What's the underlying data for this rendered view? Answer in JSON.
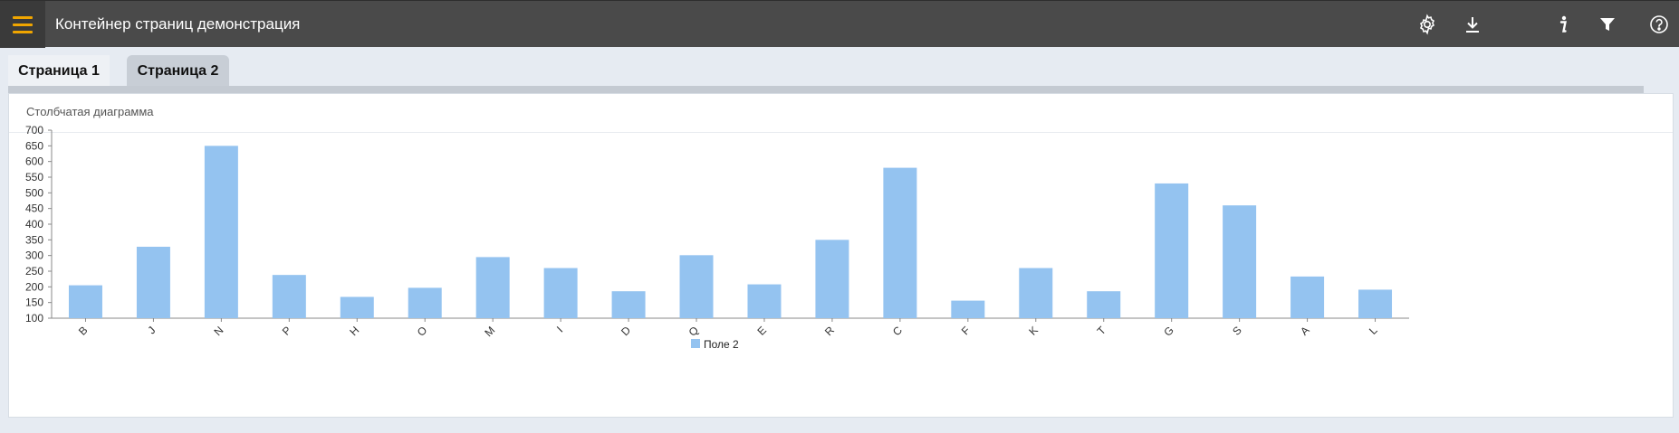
{
  "app": {
    "title": "Контейнер страниц демонстрация"
  },
  "toolbar": {
    "icons": [
      "menu-icon",
      "gear-icon",
      "download-icon",
      "info-icon",
      "filter-icon",
      "help-icon"
    ],
    "accent_color": "#f0a500"
  },
  "tabs": [
    {
      "label": "Страница 1",
      "active": false
    },
    {
      "label": "Страница 2",
      "active": true
    }
  ],
  "panel": {
    "title": "Столбчатая диаграмма"
  },
  "chart_data": {
    "type": "bar",
    "title": "",
    "xlabel": "",
    "ylabel": "",
    "categories": [
      "B",
      "J",
      "N",
      "P",
      "H",
      "O",
      "M",
      "I",
      "D",
      "Q",
      "E",
      "R",
      "C",
      "F",
      "K",
      "T",
      "G",
      "S",
      "A",
      "L"
    ],
    "series": [
      {
        "name": "Поле 2",
        "color": "#94c3f0",
        "values": [
          205,
          328,
          650,
          238,
          168,
          197,
          295,
          260,
          186,
          301,
          208,
          350,
          580,
          156,
          260,
          186,
          530,
          460,
          233,
          191
        ]
      }
    ],
    "ylim": [
      100,
      700
    ],
    "yticks": [
      "100",
      "150",
      "200",
      "250",
      "300",
      "350",
      "400",
      "450",
      "500",
      "550",
      "600",
      "650",
      "700"
    ],
    "grid": false,
    "legend": "bottom"
  }
}
